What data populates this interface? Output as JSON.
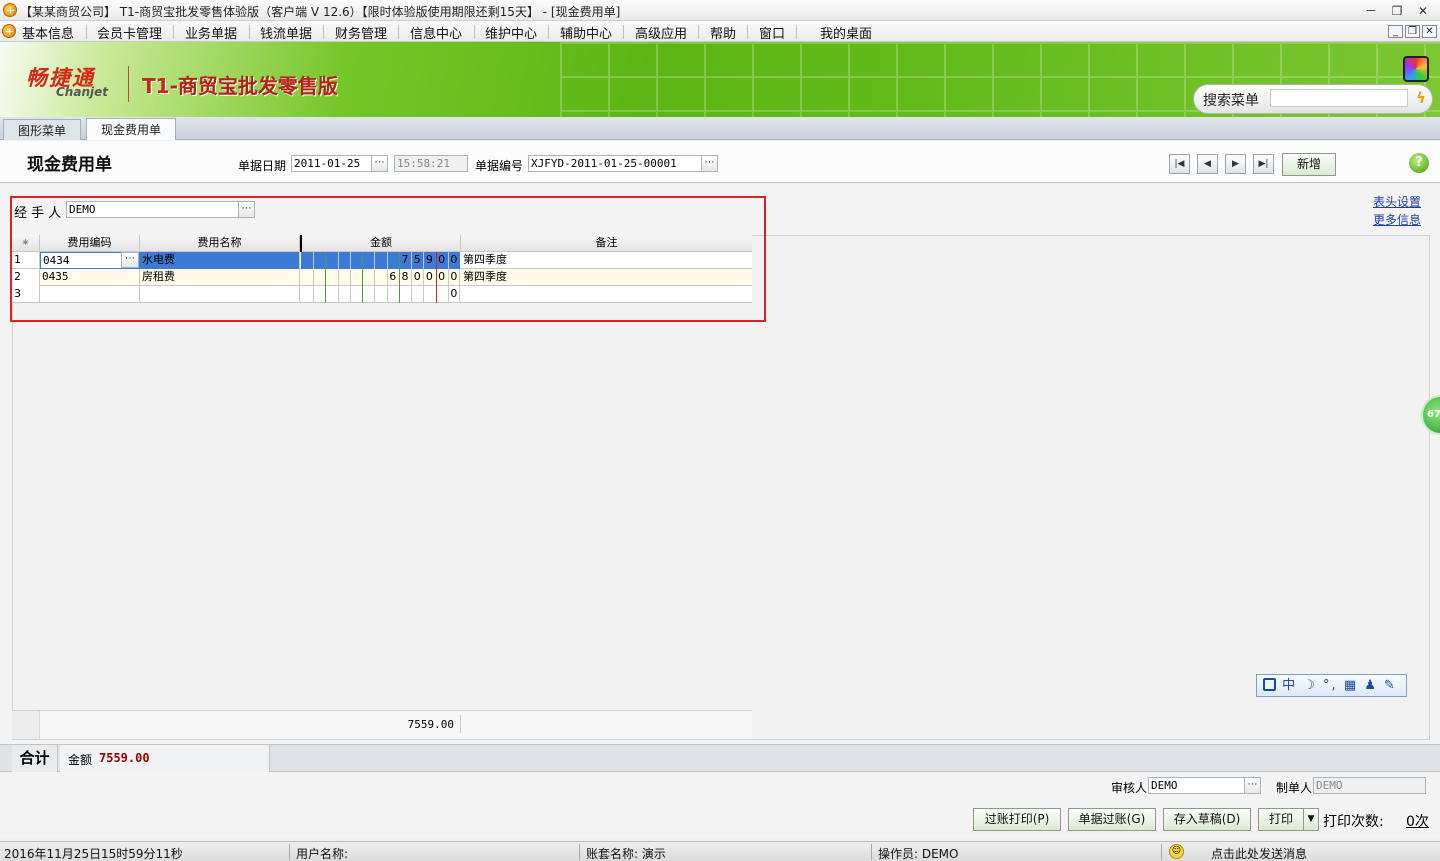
{
  "window": {
    "title": "【某某商贸公司】 T1-商贸宝批发零售体验版（客户端 V 12.6）【限时体验版使用期限还剩15天】 - [现金费用单]",
    "min": "－",
    "restore": "❐",
    "close": "✕"
  },
  "menu": [
    "基本信息",
    "会员卡管理",
    "业务单据",
    "钱流单据",
    "财务管理",
    "信息中心",
    "维护中心",
    "辅助中心",
    "高级应用",
    "帮助",
    "窗口",
    "我的桌面"
  ],
  "banner": {
    "logo_cn": "畅捷通",
    "logo_en": "Chanjet",
    "product_prefix": "T1",
    "product_name": "-商贸宝批发零售版",
    "search_label": "搜索菜单",
    "search_value": ""
  },
  "tabs": [
    {
      "label": "图形菜单",
      "active": false
    },
    {
      "label": "现金费用单",
      "active": true
    }
  ],
  "form": {
    "title": "现金费用单",
    "date_label": "单据日期",
    "date_value": "2011-01-25",
    "time_value": "15:58:21",
    "number_label": "单据编号",
    "number_value": "XJFYD-2011-01-25-00001",
    "new_button": "新增",
    "handler_label": "经 手 人",
    "handler_value": "DEMO",
    "header_settings_link": "表头设置",
    "more_info_link": "更多信息"
  },
  "grid": {
    "columns": [
      "费用编码",
      "费用名称",
      "金额",
      "备注"
    ],
    "rows": [
      {
        "no": "1",
        "code": "0434",
        "name": "水电费",
        "amount_digits": "75900",
        "remark": "第四季度",
        "selected": true
      },
      {
        "no": "2",
        "code": "0435",
        "name": "房租费",
        "amount_digits": "680000",
        "remark": "第四季度",
        "selected": false
      },
      {
        "no": "3",
        "code": "",
        "name": "",
        "amount_digits": "0",
        "remark": "",
        "selected": false
      }
    ],
    "total_amount": "7559.00"
  },
  "summary": {
    "label": "合计",
    "amount_label": "金额",
    "amount_value": "7559.00"
  },
  "footer": {
    "auditor_label": "审核人",
    "auditor_value": "DEMO",
    "maker_label": "制单人",
    "maker_value": "DEMO",
    "buttons": [
      "过账打印(P)",
      "单据过账(G)",
      "存入草稿(D)",
      "打印"
    ],
    "print_count_label": "打印次数:",
    "print_count_value": "0次"
  },
  "ime": "中 ☽ °, ▦ ♟ ✎",
  "float_badge": "67",
  "status": {
    "date": "2016年11月25日",
    "time": "15时59分11秒",
    "user_label": "用户名称:",
    "account": "账套名称: 演示",
    "operator": "操作员: DEMO",
    "message": "点击此处发送消息"
  },
  "colors": {
    "accent_green": "#5cb515",
    "highlight_red": "#e31e24",
    "selected_row": "#3d7ad6",
    "amount_red": "#a00000"
  }
}
